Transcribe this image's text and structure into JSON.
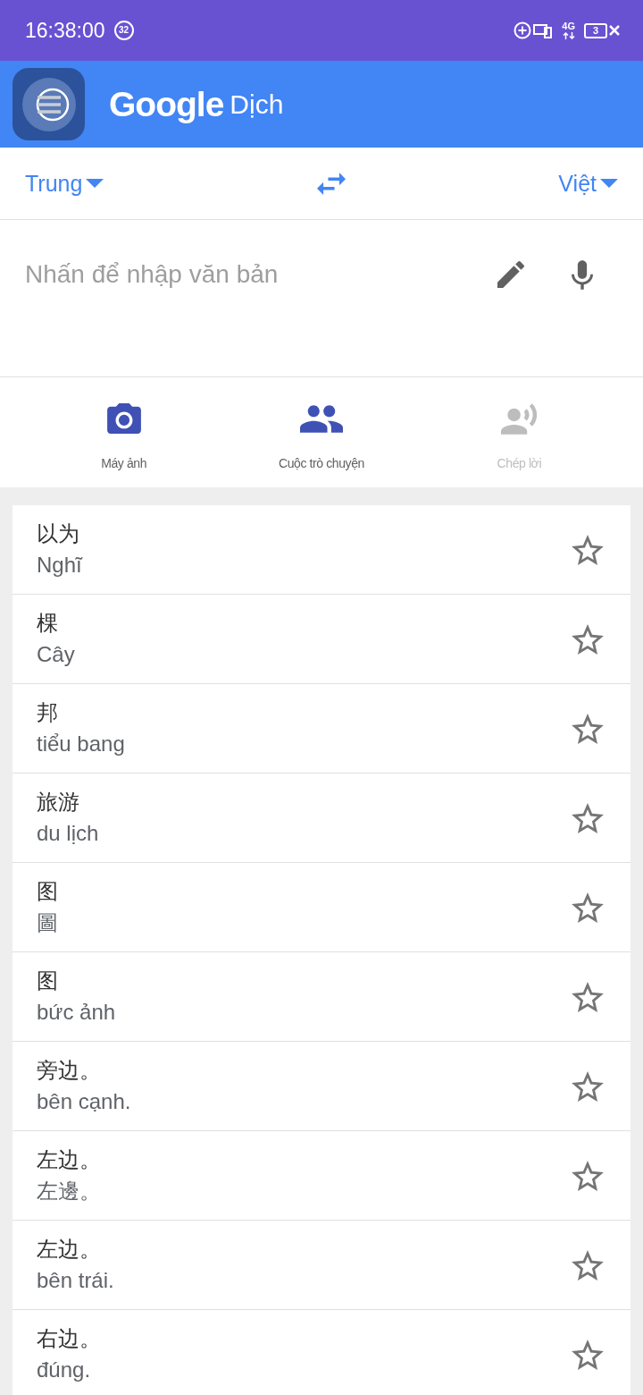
{
  "status_bar": {
    "time": "16:38:00",
    "notification_count": "32",
    "network": "4G",
    "battery": "3"
  },
  "app_bar": {
    "logo": "Google",
    "title": "Dịch"
  },
  "languages": {
    "source": "Trung",
    "target": "Việt"
  },
  "input": {
    "placeholder": "Nhấn để nhập văn bản"
  },
  "tools": [
    {
      "kind": "camera",
      "label": "Máy ảnh",
      "disabled": false
    },
    {
      "kind": "conversation",
      "label": "Cuộc trò chuyện",
      "disabled": false
    },
    {
      "kind": "transcribe",
      "label": "Chép lời",
      "disabled": true
    }
  ],
  "history": [
    {
      "source": "以为",
      "translation": "Nghĩ",
      "starred": false
    },
    {
      "source": "棵",
      "translation": "Cây",
      "starred": false
    },
    {
      "source": "邦",
      "translation": "tiểu bang",
      "starred": false
    },
    {
      "source": "旅游",
      "translation": "du lịch",
      "starred": false
    },
    {
      "source": "图",
      "translation": "圖",
      "starred": false
    },
    {
      "source": "图",
      "translation": "bức ảnh",
      "starred": false
    },
    {
      "source": "旁边。",
      "translation": "bên cạnh.",
      "starred": false
    },
    {
      "source": "左边。",
      "translation": "左邊。",
      "starred": false
    },
    {
      "source": "左边。",
      "translation": "bên trái.",
      "starred": false
    },
    {
      "source": "右边。",
      "translation": "đúng.",
      "starred": false
    }
  ]
}
